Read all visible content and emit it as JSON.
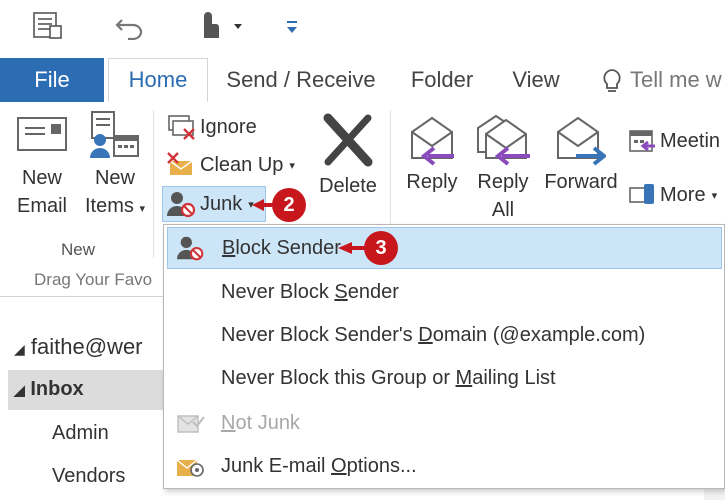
{
  "qat": {
    "icons": [
      "send-receive-all-folders-icon",
      "undo-icon",
      "touch-mode-icon",
      "customize-qat-icon"
    ]
  },
  "tabs": {
    "file": "File",
    "home": "Home",
    "send_receive": "Send / Receive",
    "folder": "Folder",
    "view": "View",
    "tell_me": "Tell me w"
  },
  "ribbon": {
    "new_email": [
      "New",
      "Email"
    ],
    "new_items": [
      "New",
      "Items"
    ],
    "new_group": "New",
    "ignore": "Ignore",
    "clean_up": "Clean Up",
    "junk": "Junk",
    "delete": "Delete",
    "reply": "Reply",
    "reply_all": [
      "Reply",
      "All"
    ],
    "forward": "Forward",
    "meeting": "Meetin",
    "more": "More"
  },
  "folder_pane": {
    "drag_hint": "Drag Your Favo",
    "account": "faithe@wer",
    "inbox": "Inbox",
    "folders": [
      "Admin",
      "Vendors"
    ]
  },
  "menu": {
    "block_sender": {
      "pre": "",
      "u": "B",
      "post": "lock Sender"
    },
    "never_block_sender": {
      "pre": "Never Block ",
      "u": "S",
      "post": "ender"
    },
    "never_block_domain": {
      "pre": "Never Block Sender's ",
      "u": "D",
      "post": "omain (@example.com)"
    },
    "never_block_group": {
      "pre": "Never Block this Group or ",
      "u": "M",
      "post": "ailing List"
    },
    "not_junk": {
      "pre": "",
      "u": "N",
      "post": "ot Junk"
    },
    "junk_options": {
      "pre": "Junk E-mail ",
      "u": "O",
      "post": "ptions..."
    }
  },
  "callouts": {
    "step2": "2",
    "step3": "3"
  },
  "colors": {
    "file_tab": "#2b6cb3",
    "highlight": "#cde6f7",
    "callout": "#c8161d"
  }
}
